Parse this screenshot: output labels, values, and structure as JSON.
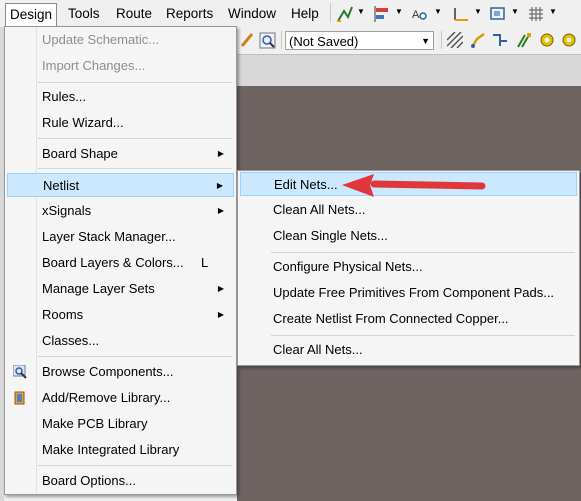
{
  "menubar": {
    "items": [
      {
        "label": "Design",
        "active": true
      },
      {
        "label": "Tools"
      },
      {
        "label": "Route"
      },
      {
        "label": "Reports"
      },
      {
        "label": "Window"
      },
      {
        "label": "Help"
      }
    ]
  },
  "toolbar": {
    "combo_value": "(Not Saved)"
  },
  "design_menu": {
    "items": [
      {
        "label": "Update Schematic...",
        "disabled": true
      },
      {
        "label": "Import Changes...",
        "disabled": true
      },
      {
        "label": "Rules..."
      },
      {
        "label": "Rule Wizard..."
      },
      {
        "label": "Board Shape",
        "submenu": true
      },
      {
        "label": "Netlist",
        "submenu": true,
        "highlight": true
      },
      {
        "label": "xSignals",
        "submenu": true
      },
      {
        "label": "Layer Stack Manager..."
      },
      {
        "label": "Board Layers & Colors...",
        "shortcut": "L"
      },
      {
        "label": "Manage Layer Sets",
        "submenu": true
      },
      {
        "label": "Rooms",
        "submenu": true
      },
      {
        "label": "Classes..."
      },
      {
        "label": "Browse Components..."
      },
      {
        "label": "Add/Remove Library..."
      },
      {
        "label": "Make PCB Library"
      },
      {
        "label": "Make Integrated Library"
      },
      {
        "label": "Board Options..."
      }
    ]
  },
  "netlist_submenu": {
    "items": [
      {
        "label": "Edit Nets...",
        "highlight": true
      },
      {
        "label": "Clean All Nets..."
      },
      {
        "label": "Clean Single Nets..."
      },
      {
        "label": "Configure Physical Nets..."
      },
      {
        "label": "Update Free Primitives From Component Pads..."
      },
      {
        "label": "Create Netlist From Connected Copper..."
      },
      {
        "label": "Clear All Nets..."
      }
    ]
  },
  "colors": {
    "highlight": "#cce8ff",
    "canvas": "#6d6462",
    "arrow": "#e0383a"
  }
}
